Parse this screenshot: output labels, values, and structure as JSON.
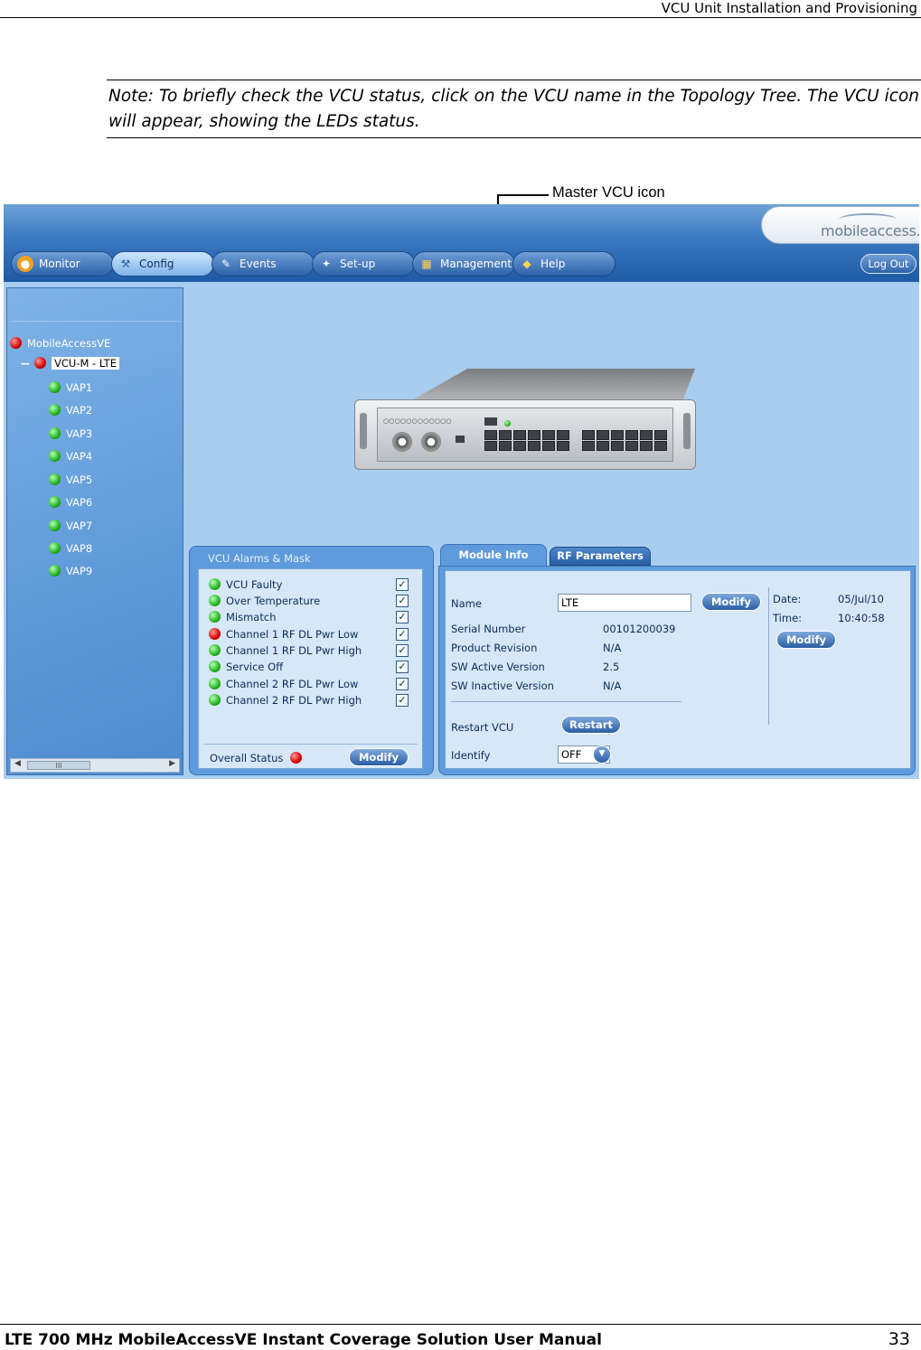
{
  "doc": {
    "header": "VCU Unit Installation and Provisioning",
    "note": "Note: To briefly check the VCU status, click on the VCU name in the Topology Tree. The VCU icon will appear, showing the LEDs status.",
    "callout": "Master VCU icon",
    "footer_title": "LTE 700 MHz MobileAccessVE Instant Coverage Solution User Manual",
    "page_number": "33"
  },
  "app": {
    "logo": "mobileaccess.",
    "nav": [
      {
        "label": "Monitor",
        "icon": "globe-icon"
      },
      {
        "label": "Config",
        "icon": "wrench-icon"
      },
      {
        "label": "Events",
        "icon": "clipboard-icon"
      },
      {
        "label": "Set-up",
        "icon": "wand-icon"
      },
      {
        "label": "Management",
        "icon": "chart-icon"
      },
      {
        "label": "Help",
        "icon": "book-icon"
      }
    ],
    "active_nav": "Config",
    "logout": "Log Out",
    "tree": {
      "root": "MobileAccessVE",
      "selected": "VCU-M - LTE",
      "children": [
        "VAP1",
        "VAP2",
        "VAP3",
        "VAP4",
        "VAP5",
        "VAP6",
        "VAP7",
        "VAP8",
        "VAP9"
      ],
      "scroll_thumb": "III"
    },
    "alarms": {
      "title": "VCU Alarms & Mask",
      "items": [
        {
          "label": "VCU Faulty",
          "status": "green",
          "checked": true
        },
        {
          "label": "Over Temperature",
          "status": "green",
          "checked": true
        },
        {
          "label": "Mismatch",
          "status": "green",
          "checked": true
        },
        {
          "label": "Channel 1 RF DL Pwr Low",
          "status": "red",
          "checked": true
        },
        {
          "label": "Channel 1 RF DL Pwr High",
          "status": "green",
          "checked": true
        },
        {
          "label": "Service Off",
          "status": "green",
          "checked": true
        },
        {
          "label": "Channel 2 RF DL Pwr Low",
          "status": "green",
          "checked": true
        },
        {
          "label": "Channel 2 RF DL Pwr High",
          "status": "green",
          "checked": true
        }
      ],
      "check_glyph": "✓",
      "overall_label": "Overall Status",
      "overall_status": "red",
      "modify": "Modify"
    },
    "module": {
      "tabs": [
        "Module Info",
        "RF Parameters"
      ],
      "name_label": "Name",
      "name_value": "LTE",
      "modify": "Modify",
      "serial_label": "Serial Number",
      "serial_value": "00101200039",
      "product_rev_label": "Product Revision",
      "product_rev_value": "N/A",
      "sw_active_label": "SW Active Version",
      "sw_active_value": "2.5",
      "sw_inactive_label": "SW Inactive Version",
      "sw_inactive_value": "N/A",
      "restart_label": "Restart VCU",
      "restart_btn": "Restart",
      "identify_label": "Identify",
      "identify_value": "OFF",
      "date_label": "Date:",
      "date_value": "05/Jul/10",
      "time_label": "Time:",
      "time_value": "10:40:58",
      "modify2": "Modify"
    },
    "device": {
      "led_strip": "○○○○○○○○○○○○"
    }
  }
}
